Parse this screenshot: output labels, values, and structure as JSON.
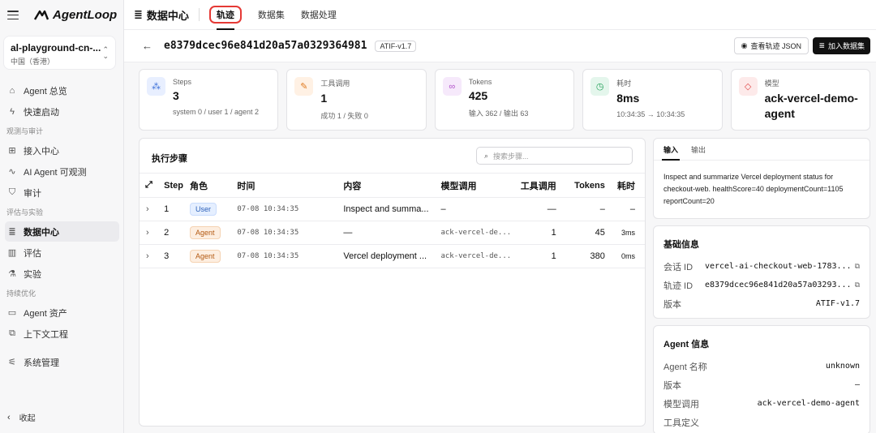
{
  "app": {
    "name": "AgentLoop"
  },
  "workspace": {
    "name": "al-playground-cn-...",
    "region": "中国（香港）"
  },
  "nav": {
    "items_top": [
      {
        "label": "Agent 总览",
        "icon": "house-icon"
      },
      {
        "label": "快速启动",
        "icon": "bolt-icon"
      }
    ],
    "group_observe": "观测与审计",
    "items_observe": [
      {
        "label": "接入中心",
        "icon": "grid-icon"
      },
      {
        "label": "AI Agent 可观测",
        "icon": "pulse-icon"
      },
      {
        "label": "审计",
        "icon": "shield-icon"
      }
    ],
    "group_eval": "评估与实验",
    "items_eval": [
      {
        "label": "数据中心",
        "icon": "database-icon",
        "active": true
      },
      {
        "label": "评估",
        "icon": "bar-chart-icon"
      },
      {
        "label": "实验",
        "icon": "flask-icon"
      }
    ],
    "group_opt": "持续优化",
    "items_opt": [
      {
        "label": "Agent 资产",
        "icon": "folder-icon"
      },
      {
        "label": "上下文工程",
        "icon": "context-icon"
      }
    ],
    "items_sys": [
      {
        "label": "系统管理",
        "icon": "sliders-icon"
      }
    ],
    "collapse_label": "收起"
  },
  "topbar": {
    "title": "数据中心",
    "tabs": [
      {
        "label": "轨迹",
        "active": true
      },
      {
        "label": "数据集"
      },
      {
        "label": "数据处理"
      }
    ]
  },
  "header": {
    "trajectory_id": "e8379dcec96e841d20a57a0329364981",
    "version_badge": "ATIF-v1.7",
    "view_json_label": "查看轨迹 JSON",
    "add_dataset_label": "加入数据集"
  },
  "cards": [
    {
      "label": "Steps",
      "value": "3",
      "sub": "system 0 / user 1 / agent 2",
      "icon": "footsteps-icon",
      "color": "#e8efff",
      "icolor": "#3b6fd8"
    },
    {
      "label": "工具调用",
      "value": "1",
      "sub": "成功 1 / 失败 0",
      "icon": "wrench-icon",
      "color": "#fff1e4",
      "icolor": "#e07a1f"
    },
    {
      "label": "Tokens",
      "value": "425",
      "sub": "输入 362 / 输出 63",
      "icon": "link-icon",
      "color": "#f6e9fb",
      "icolor": "#b04fc9"
    },
    {
      "label": "耗时",
      "value": "8ms",
      "sub": "10:34:35 → 10:34:35",
      "icon": "clock-icon",
      "color": "#e4f6ec",
      "icolor": "#23a15a"
    },
    {
      "label": "模型",
      "value": "ack-vercel-demo-agent",
      "sub": "",
      "icon": "diamond-icon",
      "color": "#fdeaea",
      "icolor": "#e04848"
    }
  ],
  "steps_panel": {
    "title": "执行步骤",
    "search_placeholder": "搜索步骤...",
    "columns": [
      "Step",
      "角色",
      "时间",
      "内容",
      "模型调用",
      "工具调用",
      "Tokens",
      "耗时"
    ],
    "rows": [
      {
        "step": "1",
        "role": "User",
        "time": "07-08 10:34:35",
        "content": "Inspect and summa...",
        "model": "–",
        "tools": "—",
        "tokens": "–",
        "duration": "–"
      },
      {
        "step": "2",
        "role": "Agent",
        "time": "07-08 10:34:35",
        "content": "—",
        "model": "ack-vercel-de...",
        "tools": "1",
        "tokens": "45",
        "duration": "3ms"
      },
      {
        "step": "3",
        "role": "Agent",
        "time": "07-08 10:34:35",
        "content": "Vercel deployment ...",
        "model": "ack-vercel-de...",
        "tools": "1",
        "tokens": "380",
        "duration": "0ms"
      }
    ]
  },
  "io_panel": {
    "tabs": [
      {
        "label": "输入",
        "active": true
      },
      {
        "label": "输出"
      }
    ],
    "text": "Inspect and summarize Vercel deployment status for checkout-web. healthScore=40 deploymentCount=1105 reportCount=20"
  },
  "basic_info": {
    "title": "基础信息",
    "rows": [
      {
        "key": "会话 ID",
        "value": "vercel-ai-checkout-web-1783...",
        "copy": true
      },
      {
        "key": "轨迹 ID",
        "value": "e8379dcec96e841d20a57a03293...",
        "copy": true
      },
      {
        "key": "版本",
        "value": "ATIF-v1.7",
        "copy": false
      }
    ]
  },
  "agent_info": {
    "title": "Agent 信息",
    "rows": [
      {
        "key": "Agent 名称",
        "value": "unknown"
      },
      {
        "key": "版本",
        "value": "–"
      },
      {
        "key": "模型调用",
        "value": "ack-vercel-demo-agent"
      },
      {
        "key": "工具定义",
        "value": ""
      }
    ]
  }
}
